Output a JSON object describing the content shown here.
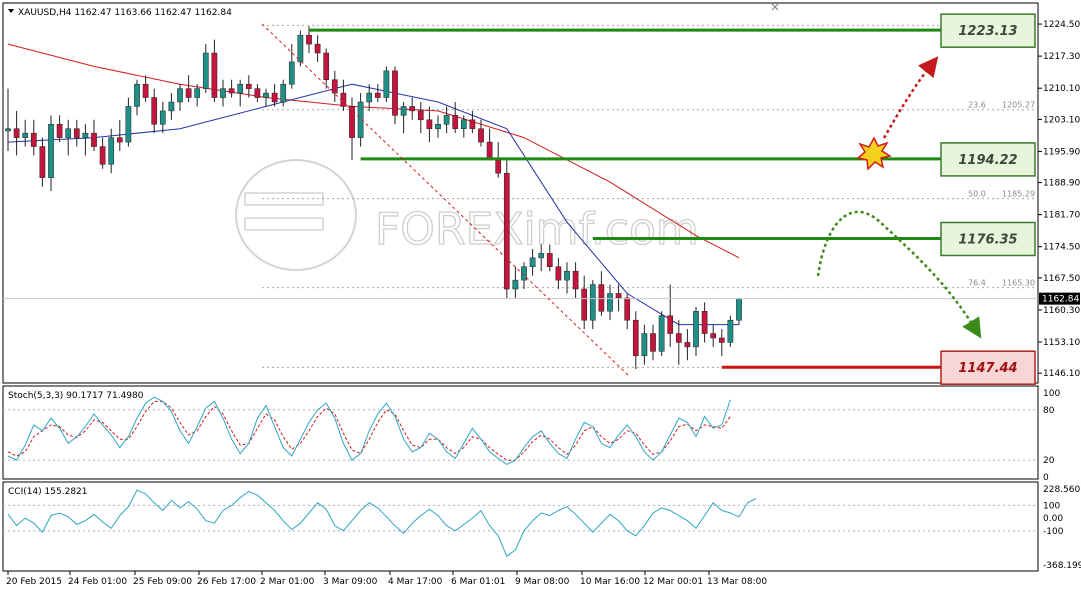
{
  "chart_data": {
    "type": "candlestick",
    "symbol_header": "XAUUSD,H4  1162.47 1163.66 1162.47 1162.84",
    "watermark": "FOREXimf.com",
    "price_axis": {
      "ylim": [
        1144.5,
        1226.2
      ],
      "ticks": [
        "1224.50",
        "1217.30",
        "1210.10",
        "1203.10",
        "1195.90",
        "1188.90",
        "1181.70",
        "1174.50",
        "1167.50",
        "1160.30",
        "1153.10",
        "1146.10"
      ],
      "tick_values": [
        1224.5,
        1217.3,
        1210.1,
        1203.1,
        1195.9,
        1188.9,
        1181.7,
        1174.5,
        1167.5,
        1160.3,
        1153.1,
        1146.1
      ],
      "current_price_label": "1162.84",
      "current_price": 1162.84
    },
    "time_axis": [
      "20 Feb 2015",
      "24 Feb 01:00",
      "25 Feb 09:00",
      "26 Feb 17:00",
      "2 Mar 01:00",
      "3 Mar 09:00",
      "4 Mar 17:00",
      "6 Mar 01:01",
      "9 Mar 08:00",
      "10 Mar 16:00",
      "12 Mar 00:01",
      "13 Mar 08:00"
    ],
    "candles_ohlc": [
      [
        1200.5,
        1210,
        1196,
        1201
      ],
      [
        1201,
        1205,
        1195,
        1199
      ],
      [
        1199,
        1203,
        1197,
        1200
      ],
      [
        1200,
        1203,
        1195,
        1197
      ],
      [
        1197,
        1199,
        1188,
        1190
      ],
      [
        1190,
        1204,
        1187,
        1202
      ],
      [
        1202,
        1204,
        1198,
        1199
      ],
      [
        1199,
        1203,
        1195,
        1201
      ],
      [
        1201,
        1203,
        1197,
        1199
      ],
      [
        1199,
        1202,
        1195,
        1200
      ],
      [
        1200,
        1203,
        1196,
        1197
      ],
      [
        1197,
        1199,
        1192,
        1193
      ],
      [
        1193,
        1201,
        1191,
        1199
      ],
      [
        1199,
        1203,
        1196,
        1198
      ],
      [
        1198,
        1208,
        1197,
        1206
      ],
      [
        1206,
        1212,
        1204,
        1211
      ],
      [
        1211,
        1213,
        1207,
        1208
      ],
      [
        1208,
        1210,
        1200,
        1202
      ],
      [
        1202,
        1207,
        1200,
        1205
      ],
      [
        1205,
        1209,
        1203,
        1207
      ],
      [
        1207,
        1211,
        1205,
        1210
      ],
      [
        1210,
        1213,
        1207,
        1208
      ],
      [
        1208,
        1211,
        1206,
        1210
      ],
      [
        1210,
        1220,
        1209,
        1218
      ],
      [
        1218,
        1221,
        1207,
        1208
      ],
      [
        1208,
        1212,
        1206,
        1210
      ],
      [
        1210,
        1212,
        1208,
        1209
      ],
      [
        1209,
        1212,
        1206,
        1211
      ],
      [
        1211,
        1213,
        1208,
        1210
      ],
      [
        1210,
        1211,
        1207,
        1208
      ],
      [
        1208,
        1210,
        1206,
        1209
      ],
      [
        1209,
        1211,
        1206,
        1207
      ],
      [
        1207,
        1212,
        1206,
        1211
      ],
      [
        1211,
        1220,
        1210,
        1216
      ],
      [
        1216,
        1223,
        1215,
        1222
      ],
      [
        1222,
        1224,
        1218,
        1220
      ],
      [
        1220,
        1222,
        1216,
        1218
      ],
      [
        1218,
        1219,
        1210,
        1212
      ],
      [
        1212,
        1214,
        1207,
        1209
      ],
      [
        1209,
        1212,
        1205,
        1206
      ],
      [
        1206,
        1208,
        1194,
        1199
      ],
      [
        1199,
        1209,
        1197,
        1207
      ],
      [
        1207,
        1211,
        1205,
        1209
      ],
      [
        1209,
        1211,
        1207,
        1208
      ],
      [
        1208,
        1215,
        1207,
        1214
      ],
      [
        1214,
        1215,
        1202,
        1204
      ],
      [
        1204,
        1207,
        1200,
        1206
      ],
      [
        1206,
        1208,
        1203,
        1205
      ],
      [
        1205,
        1207,
        1200,
        1203
      ],
      [
        1203,
        1206,
        1198,
        1201
      ],
      [
        1201,
        1204,
        1199,
        1202
      ],
      [
        1202,
        1206,
        1200,
        1204
      ],
      [
        1204,
        1207,
        1200,
        1201
      ],
      [
        1201,
        1204,
        1199,
        1203
      ],
      [
        1203,
        1205,
        1200,
        1201
      ],
      [
        1201,
        1203,
        1197,
        1198
      ],
      [
        1198,
        1201,
        1194,
        1194
      ],
      [
        1194,
        1198,
        1190,
        1191
      ],
      [
        1191,
        1194,
        1163,
        1165
      ],
      [
        1165,
        1170,
        1163,
        1167
      ],
      [
        1167,
        1171,
        1165,
        1170
      ],
      [
        1170,
        1174,
        1168,
        1172
      ],
      [
        1172,
        1175,
        1169,
        1173
      ],
      [
        1173,
        1175,
        1169,
        1170
      ],
      [
        1170,
        1172,
        1165,
        1167
      ],
      [
        1167,
        1171,
        1164,
        1169
      ],
      [
        1169,
        1171,
        1163,
        1165
      ],
      [
        1165,
        1168,
        1156,
        1158
      ],
      [
        1158,
        1167,
        1156,
        1166
      ],
      [
        1166,
        1169,
        1159,
        1160
      ],
      [
        1160,
        1166,
        1158,
        1164
      ],
      [
        1164,
        1166,
        1160,
        1163
      ],
      [
        1163,
        1164,
        1156,
        1158
      ],
      [
        1158,
        1160,
        1147,
        1150
      ],
      [
        1150,
        1157,
        1148,
        1155
      ],
      [
        1155,
        1157,
        1149,
        1151
      ],
      [
        1151,
        1160,
        1150,
        1159
      ],
      [
        1159,
        1166,
        1152,
        1155
      ],
      [
        1155,
        1158,
        1148,
        1153
      ],
      [
        1153,
        1156,
        1149,
        1152
      ],
      [
        1152,
        1161,
        1150,
        1160
      ],
      [
        1160,
        1162,
        1153,
        1155
      ],
      [
        1155,
        1157,
        1152,
        1154
      ],
      [
        1154,
        1156,
        1150,
        1153
      ],
      [
        1153,
        1159,
        1152,
        1158
      ],
      [
        1158,
        1163,
        1157,
        1162.84
      ]
    ],
    "moving_averages": [
      {
        "color": "#d21c1c",
        "points": [
          [
            0,
            1220
          ],
          [
            10,
            1215
          ],
          [
            20,
            1211
          ],
          [
            30,
            1208
          ],
          [
            40,
            1206
          ],
          [
            50,
            1205
          ],
          [
            60,
            1199
          ],
          [
            70,
            1189
          ],
          [
            80,
            1177
          ],
          [
            85,
            1172
          ]
        ]
      },
      {
        "color": "#2533a6",
        "points": [
          [
            0,
            1198
          ],
          [
            10,
            1199
          ],
          [
            20,
            1201
          ],
          [
            30,
            1206
          ],
          [
            40,
            1211
          ],
          [
            50,
            1207
          ],
          [
            58,
            1201
          ],
          [
            65,
            1180
          ],
          [
            72,
            1164
          ],
          [
            78,
            1157
          ],
          [
            85,
            1157
          ]
        ]
      }
    ],
    "horizontal_levels": [
      {
        "label": "1223.13",
        "value": 1223.13,
        "line_color": "#1e8a12",
        "box_fill": "#e8f4dc",
        "box_stroke": "#3a7a2a",
        "text_color": "#3a4a3a",
        "start": 35
      },
      {
        "label": "1194.22",
        "value": 1194.22,
        "line_color": "#1e8a12",
        "box_fill": "#e8f4dc",
        "box_stroke": "#3a7a2a",
        "text_color": "#3a4a3a",
        "start": 41
      },
      {
        "label": "1176.35",
        "value": 1176.35,
        "line_color": "#1e8a12",
        "box_fill": "#e8f4dc",
        "box_stroke": "#3a7a2a",
        "text_color": "#3a4a3a",
        "start": 68
      },
      {
        "label": "1147.44",
        "value": 1147.44,
        "line_color": "#cc1010",
        "box_fill": "#f8d6d6",
        "box_stroke": "#b02020",
        "text_color": "#a01010",
        "start": 83
      }
    ],
    "fibonacci": [
      {
        "ratio": "23.6",
        "price": "1205.27",
        "value": 1205.27
      },
      {
        "ratio": "50.0",
        "price": "1185.29",
        "value": 1185.29
      },
      {
        "ratio": "76.4",
        "price": "1165.30",
        "value": 1165.3
      }
    ],
    "fib_lines": [
      1224.2,
      1205.27,
      1185.29,
      1165.3,
      1147.4
    ],
    "stochastic": {
      "label": "Stoch(5,3,3) 90.1717 71.4980",
      "ticks": [
        "100",
        "80",
        "20",
        "0"
      ],
      "tick_values": [
        100,
        80,
        20,
        0
      ],
      "main": [
        25,
        20,
        38,
        62,
        55,
        70,
        58,
        40,
        48,
        60,
        75,
        62,
        50,
        35,
        48,
        70,
        88,
        95,
        90,
        78,
        55,
        40,
        60,
        82,
        90,
        70,
        45,
        28,
        40,
        70,
        85,
        60,
        35,
        25,
        45,
        65,
        80,
        88,
        70,
        40,
        20,
        28,
        55,
        75,
        88,
        72,
        45,
        30,
        35,
        52,
        45,
        30,
        22,
        40,
        58,
        45,
        30,
        22,
        15,
        20,
        35,
        48,
        55,
        40,
        28,
        22,
        45,
        65,
        60,
        40,
        35,
        50,
        62,
        48,
        30,
        20,
        30,
        50,
        70,
        65,
        48,
        72,
        58,
        62,
        92
      ],
      "signal": [
        30,
        25,
        30,
        48,
        55,
        62,
        60,
        50,
        47,
        55,
        68,
        65,
        55,
        45,
        45,
        60,
        78,
        90,
        90,
        82,
        65,
        50,
        55,
        72,
        84,
        75,
        55,
        38,
        40,
        58,
        75,
        68,
        48,
        33,
        40,
        55,
        72,
        82,
        75,
        52,
        32,
        28,
        45,
        65,
        80,
        75,
        55,
        38,
        35,
        45,
        45,
        35,
        28,
        35,
        48,
        45,
        35,
        27,
        20,
        20,
        30,
        42,
        50,
        45,
        35,
        27,
        38,
        55,
        60,
        48,
        40,
        45,
        55,
        52,
        38,
        27,
        30,
        43,
        60,
        63,
        55,
        62,
        60,
        58,
        72
      ],
      "main_color": "#2ea6c9",
      "signal_color": "#d21c1c"
    },
    "cci": {
      "label": "CCI(14) 155.2821",
      "ticks": [
        "228.5607",
        "100",
        "0.00",
        "-100",
        "-368.1993"
      ],
      "tick_values": [
        228.56,
        100,
        0,
        -100,
        -368.2
      ],
      "ylim": [
        -368.2,
        228.56
      ],
      "values": [
        30,
        -60,
        0,
        -40,
        -110,
        20,
        40,
        10,
        -50,
        -20,
        30,
        -30,
        -80,
        20,
        90,
        220,
        190,
        120,
        60,
        140,
        80,
        130,
        70,
        -20,
        -40,
        60,
        100,
        160,
        210,
        180,
        120,
        60,
        -20,
        -90,
        -40,
        40,
        120,
        70,
        -60,
        -100,
        -20,
        60,
        120,
        80,
        10,
        -60,
        -120,
        -40,
        20,
        70,
        20,
        -60,
        -100,
        -50,
        0,
        60,
        -60,
        -140,
        -300,
        -250,
        -100,
        -20,
        40,
        20,
        60,
        90,
        30,
        -40,
        -110,
        -40,
        30,
        -20,
        -100,
        -140,
        -60,
        40,
        80,
        60,
        20,
        -20,
        -80,
        20,
        120,
        60,
        40,
        10,
        120,
        155
      ]
    }
  }
}
